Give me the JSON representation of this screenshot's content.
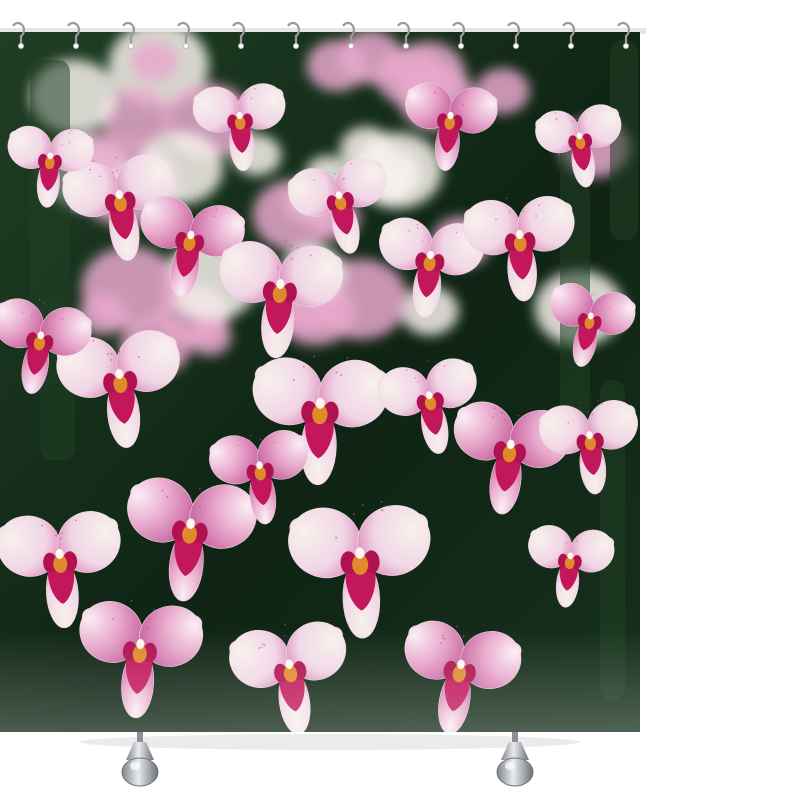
{
  "product": {
    "type": "shower-curtain",
    "print": "pink-and-white-phalaenopsis-orchids",
    "hooks_visible": 12,
    "feet_visible": 2
  },
  "colors": {
    "background": "#ffffff",
    "rod": "#e6e6e6",
    "foliage_dark": "#0f2414",
    "foliage_mid": "#1f3f24",
    "petal_white": "#f7f1ec",
    "petal_blush": "#e8a8cc",
    "petal_pink": "#d77ab0",
    "lip_magenta": "#c2185b",
    "throat_orange": "#e08a2c",
    "hook_metal": "#9a9a9a",
    "foot_chrome": "#b9bcc0",
    "shadow": "#e2e2e2"
  },
  "icons": [
    "curtain-hook-icon",
    "curtain-foot-icon",
    "orchid-flower-icon"
  ]
}
